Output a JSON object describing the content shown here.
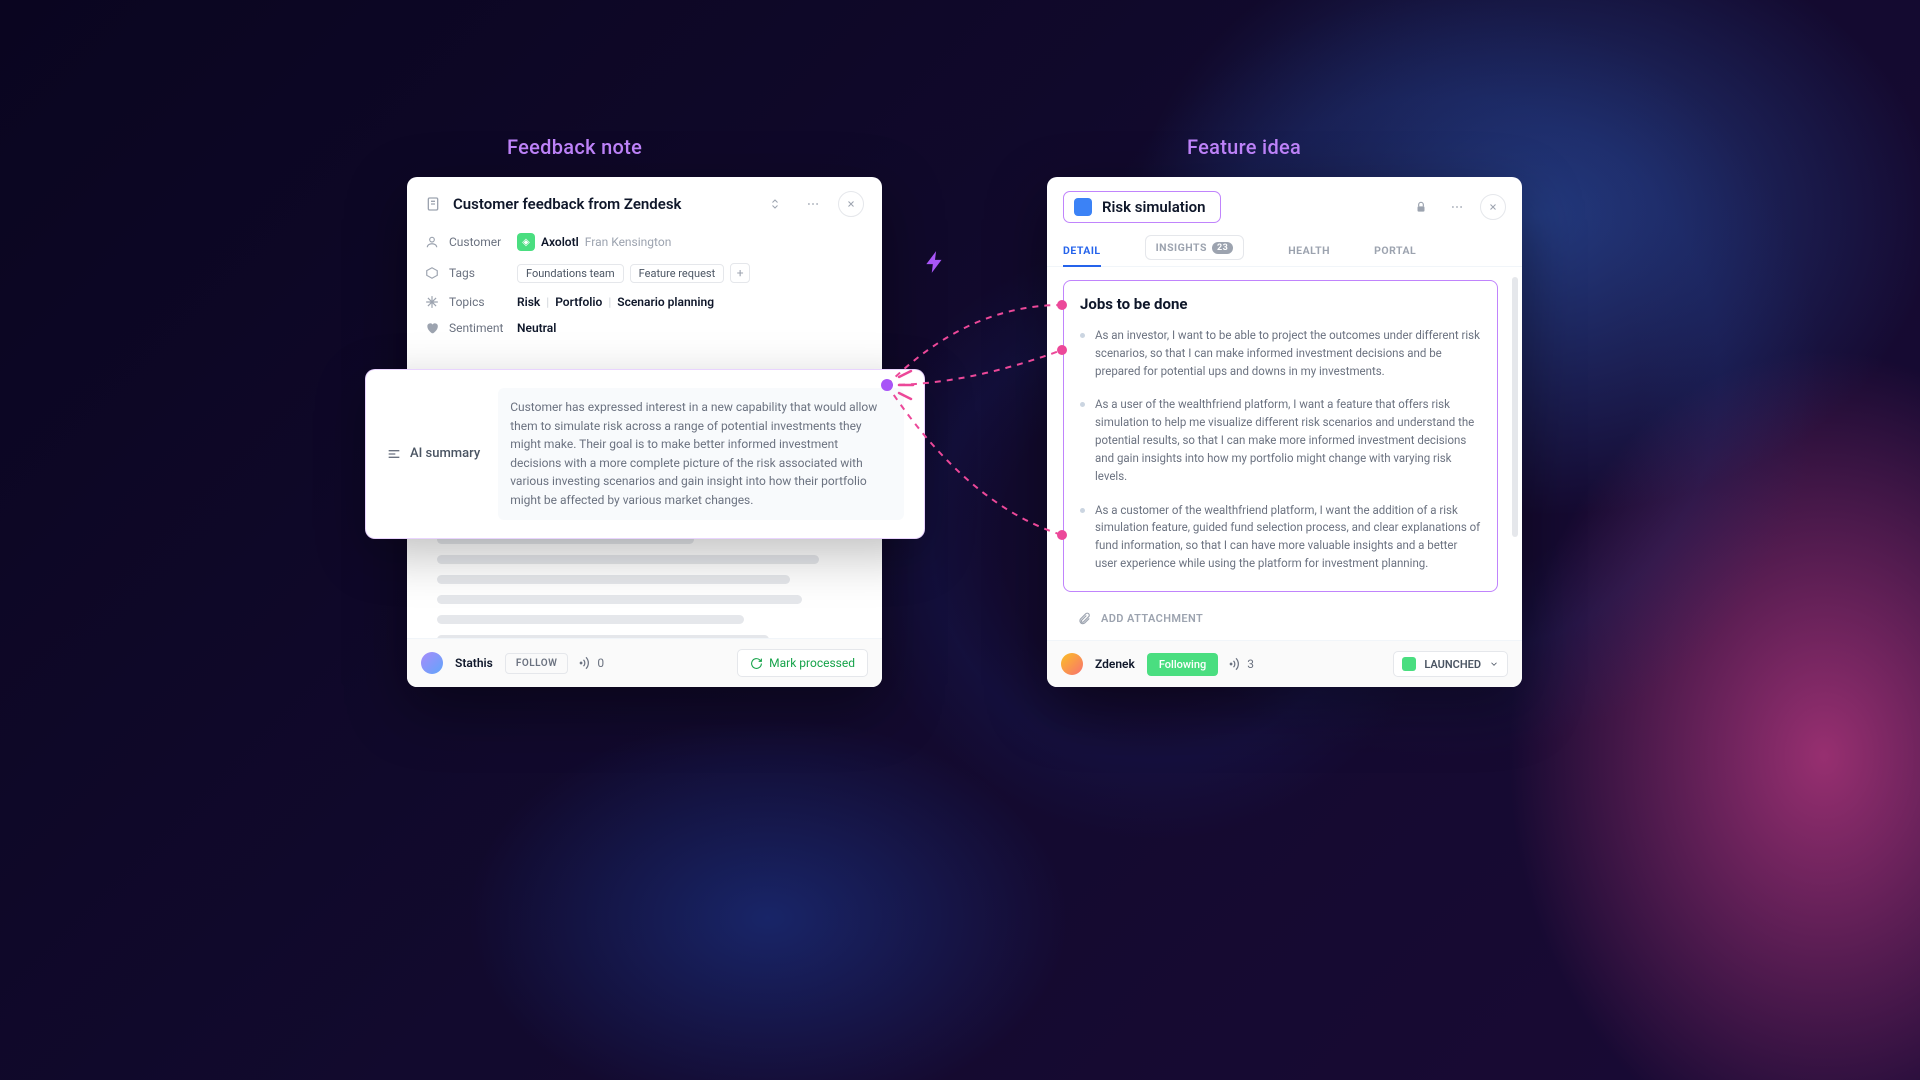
{
  "labels": {
    "left": "Feedback note",
    "right": "Feature idea"
  },
  "feedback": {
    "title": "Customer feedback from Zendesk",
    "meta": {
      "customer_label": "Customer",
      "company": "Axolotl",
      "person": "Fran Kensington",
      "tags_label": "Tags",
      "tags": [
        "Foundations team",
        "Feature request"
      ],
      "topics_label": "Topics",
      "topics": [
        "Risk",
        "Portfolio",
        "Scenario planning"
      ],
      "sentiment_label": "Sentiment",
      "sentiment": "Neutral"
    },
    "ai_summary_label": "AI summary",
    "ai_summary_text": "Customer has expressed interest in a new capability that would allow them to simulate risk across a range of potential investments they might make. Their goal is to make better informed investment decisions with a more complete picture of the risk associated with various investing scenarios and gain insight into how their portfolio might be affected by various market changes.",
    "footer": {
      "author": "Stathis",
      "follow_label": "FOLLOW",
      "followers": "0",
      "mark_label": "Mark processed"
    }
  },
  "feature": {
    "title": "Risk simulation",
    "tabs": {
      "detail": "DETAIL",
      "insights": "INSIGHTS",
      "insights_count": "23",
      "health": "HEALTH",
      "portal": "PORTAL"
    },
    "jobs_title": "Jobs to be done",
    "jobs": [
      "As an investor, I want to be able to project the outcomes under different risk scenarios, so that I can make informed investment decisions and be prepared for potential ups and downs in my investments.",
      "As a user of the wealthfriend platform, I want a feature that offers risk simulation to help me visualize different risk scenarios and understand the potential results, so that I can make more informed investment decisions and gain insights into how my portfolio might change with varying risk levels.",
      "As a customer of the wealthfriend platform, I want the addition of a risk simulation feature, guided fund selection process, and clear explanations of fund information, so that I can have more valuable insights and a better user experience while using the platform for investment planning."
    ],
    "attach_label": "ADD ATTACHMENT",
    "footer": {
      "author": "Zdenek",
      "following_label": "Following",
      "followers": "3",
      "status": "LAUNCHED"
    }
  }
}
